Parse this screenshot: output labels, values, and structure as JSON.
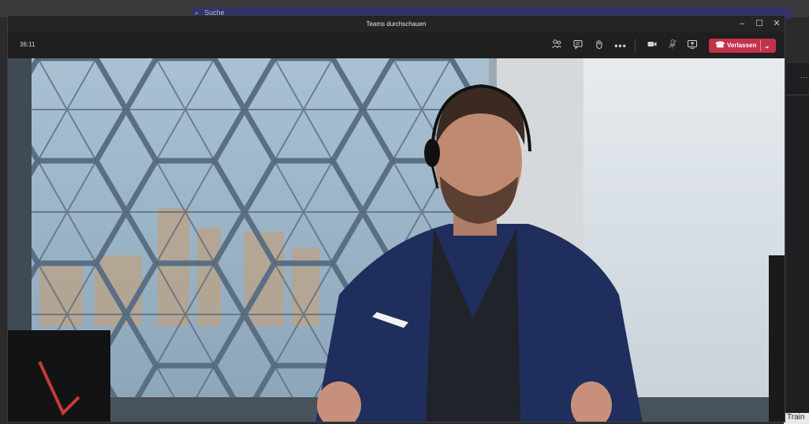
{
  "window": {
    "title": "Teams durchschauen"
  },
  "background": {
    "search_placeholder": "Suche",
    "side_badge": "Train"
  },
  "call": {
    "timer": "36:11",
    "leave_label": "Verlassen"
  },
  "icons": {
    "people": "people-icon",
    "chat": "chat-icon",
    "raise_hand": "raise-hand-icon",
    "more": "more-icon",
    "camera": "camera-icon",
    "mic_muted": "mic-muted-icon",
    "share": "share-screen-icon",
    "hangup": "hang-up-icon"
  },
  "colors": {
    "leave": "#c4314b",
    "window_bg": "#1f1f1f",
    "search_bar": "#33336b"
  }
}
